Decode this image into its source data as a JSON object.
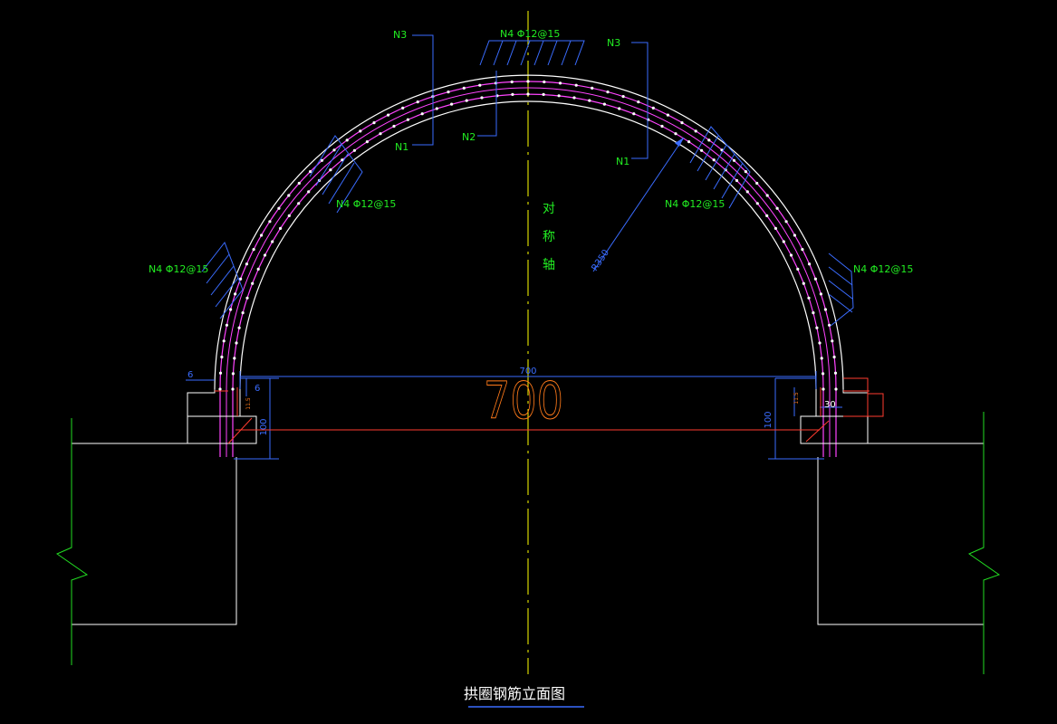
{
  "title": "拱圈钢筋立面图",
  "axis_label": [
    "对",
    "称",
    "轴"
  ],
  "radius_label": "R350",
  "span_label_small": "700",
  "span_label_big": "700",
  "rebar_labels": {
    "n4_top": "N4 Φ12@15",
    "n4_upper_left": "N4 Φ12@15",
    "n4_upper_right": "N4 Φ12@15",
    "n4_lower_left": "N4 Φ12@15",
    "n4_lower_right": "N4 Φ12@15",
    "n3_left": "N3",
    "n3_right": "N3",
    "n1_left": "N1",
    "n1_right": "N1",
    "n2": "N2"
  },
  "dimensions": {
    "left_6_top": "6",
    "left_6_side": "6",
    "left_100": "100",
    "left_small": "11.5",
    "right_100": "100",
    "right_30": "30",
    "right_small": "11.5"
  },
  "colors": {
    "arch_outline": "#ffffff",
    "rebar": "#ff44ff",
    "rebar_dots": "#ffffff",
    "axis": "#ffff00",
    "label": "#22ee22",
    "dimension": "#3a6cff",
    "red_line": "#ff3b2f",
    "orange_text": "#ff7a1a",
    "ground": "#22dd22"
  }
}
